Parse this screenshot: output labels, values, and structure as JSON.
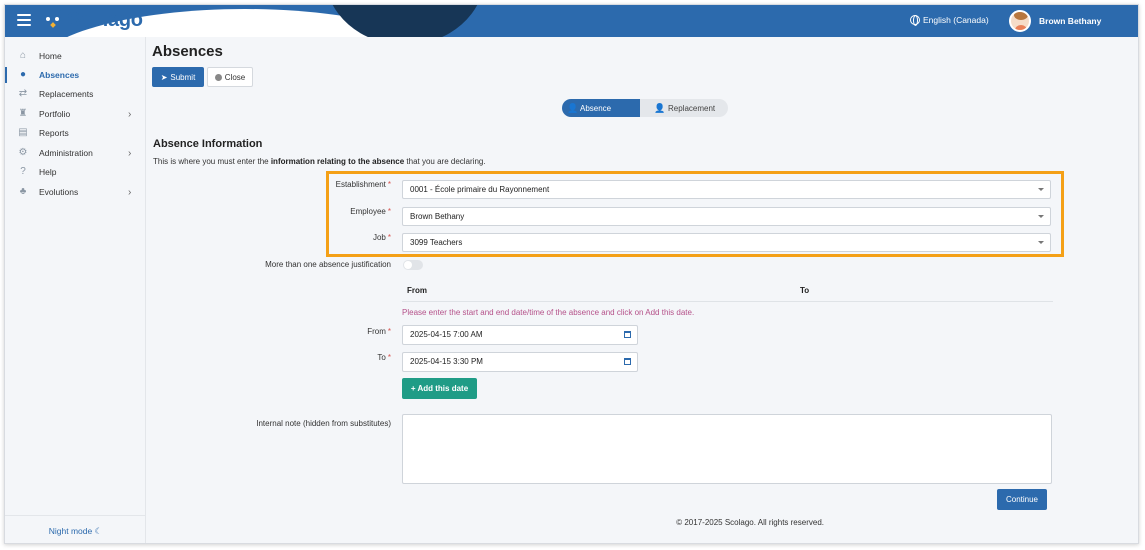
{
  "brand": {
    "name": "Scolago",
    "color": "#2c6aad"
  },
  "topbar": {
    "language": "English (Canada)",
    "user_name": "Brown Bethany"
  },
  "sidebar": {
    "items": [
      {
        "label": "Home",
        "icon": "home-icon"
      },
      {
        "label": "Absences",
        "icon": "absences-icon",
        "active": true
      },
      {
        "label": "Replacements",
        "icon": "replacements-icon"
      },
      {
        "label": "Portfolio",
        "icon": "trophy-icon",
        "has_children": true
      },
      {
        "label": "Reports",
        "icon": "reports-icon"
      },
      {
        "label": "Administration",
        "icon": "gear-icon",
        "has_children": true
      },
      {
        "label": "Help",
        "icon": "question-icon"
      },
      {
        "label": "Evolutions",
        "icon": "plant-icon",
        "has_children": true
      }
    ],
    "night_mode": "Night mode"
  },
  "page": {
    "title": "Absences",
    "submit_label": "Submit",
    "close_label": "Close",
    "steps": [
      "Absence",
      "Replacement"
    ],
    "section_title": "Absence Information",
    "section_desc_prefix": "This is where you must enter the ",
    "section_desc_bold": "information relating to the absence",
    "section_desc_suffix": " that you are declaring."
  },
  "form": {
    "establishment_label": "Establishment",
    "establishment_value": "0001 - École primaire du Rayonnement",
    "employee_label": "Employee",
    "employee_value": "Brown Bethany",
    "job_label": "Job",
    "job_value": "3099 Teachers",
    "multi_justification_label": "More than one absence justification",
    "col_from": "From",
    "col_to": "To",
    "hint": "Please enter the start and end date/time of the absence and click on Add this date.",
    "from_label": "From",
    "from_value": "2025-04-15 7:00 AM",
    "to_label": "To",
    "to_value": "2025-04-15 3:30 PM",
    "add_date_label": "Add this date",
    "internal_note_label": "Internal note (hidden from substitutes)",
    "continue_label": "Continue"
  },
  "footer": {
    "copyright": "© 2017-2025 Scolago. All rights reserved."
  },
  "colors": {
    "highlight": "#f4a017",
    "add_button": "#1f9c86",
    "hint_text": "#b5528a"
  }
}
